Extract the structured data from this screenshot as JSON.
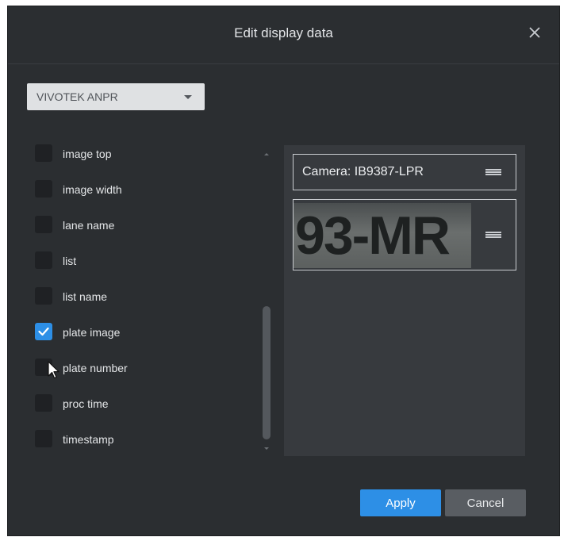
{
  "dialog": {
    "title": "Edit display data",
    "close_icon": "close-icon"
  },
  "source_select": {
    "value": "VIVOTEK ANPR"
  },
  "fields": [
    {
      "label": "image top",
      "checked": false
    },
    {
      "label": "image width",
      "checked": false
    },
    {
      "label": "lane name",
      "checked": false
    },
    {
      "label": "list",
      "checked": false
    },
    {
      "label": "list name",
      "checked": false
    },
    {
      "label": "plate image",
      "checked": true
    },
    {
      "label": "plate number",
      "checked": false
    },
    {
      "label": "proc time",
      "checked": false
    },
    {
      "label": "timestamp",
      "checked": false
    }
  ],
  "preview": {
    "camera_label": "Camera: IB9387-LPR",
    "plate_image_text": "93-MR"
  },
  "buttons": {
    "apply": "Apply",
    "cancel": "Cancel"
  },
  "colors": {
    "accent": "#2d8fe6",
    "dialog_bg": "#2b2e31",
    "panel_bg": "#373a3e"
  }
}
